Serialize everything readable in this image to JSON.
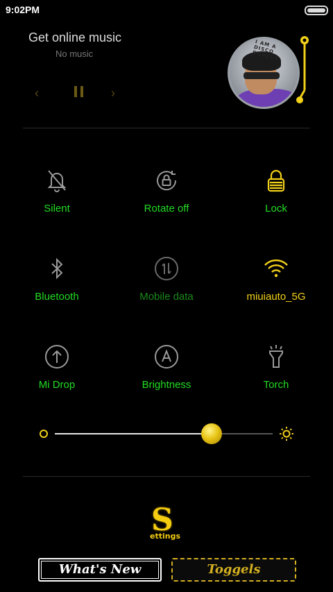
{
  "status_bar": {
    "time": "9:02PM"
  },
  "music": {
    "title": "Get online music",
    "subtitle": "No music",
    "album_text": "I AM A DISCO DANCER"
  },
  "toggles": [
    {
      "id": "silent",
      "label": "Silent",
      "icon": "bell-off-icon",
      "color": "#22dd22"
    },
    {
      "id": "rotate",
      "label": "Rotate off",
      "icon": "rotation-lock-icon",
      "color": "#22dd22"
    },
    {
      "id": "lock",
      "label": "Lock",
      "icon": "padlock-icon",
      "color": "#22dd22"
    },
    {
      "id": "bluetooth",
      "label": "Bluetooth",
      "icon": "bluetooth-icon",
      "color": "#22dd22"
    },
    {
      "id": "mobiledata",
      "label": "Mobile data",
      "icon": "mobile-data-icon",
      "color": "#1a8a1a"
    },
    {
      "id": "wifi",
      "label": "miuiauto_5G",
      "icon": "wifi-icon",
      "color": "#f2d11a"
    },
    {
      "id": "midrop",
      "label": "Mi Drop",
      "icon": "upload-arrow-icon",
      "color": "#22dd22"
    },
    {
      "id": "brightness",
      "label": "Brightness",
      "icon": "auto-brightness-icon",
      "color": "#22dd22"
    },
    {
      "id": "torch",
      "label": "Torch",
      "icon": "flashlight-icon",
      "color": "#22dd22"
    }
  ],
  "brightness": {
    "level": 0.72
  },
  "settings_logo": {
    "big": "S",
    "small": "ettings"
  },
  "buttons": {
    "whats_new": "What's New",
    "toggels": "Toggels"
  },
  "colors": {
    "accent": "#f2d11a",
    "label_green": "#22dd22",
    "dim_green": "#1a8a1a"
  }
}
